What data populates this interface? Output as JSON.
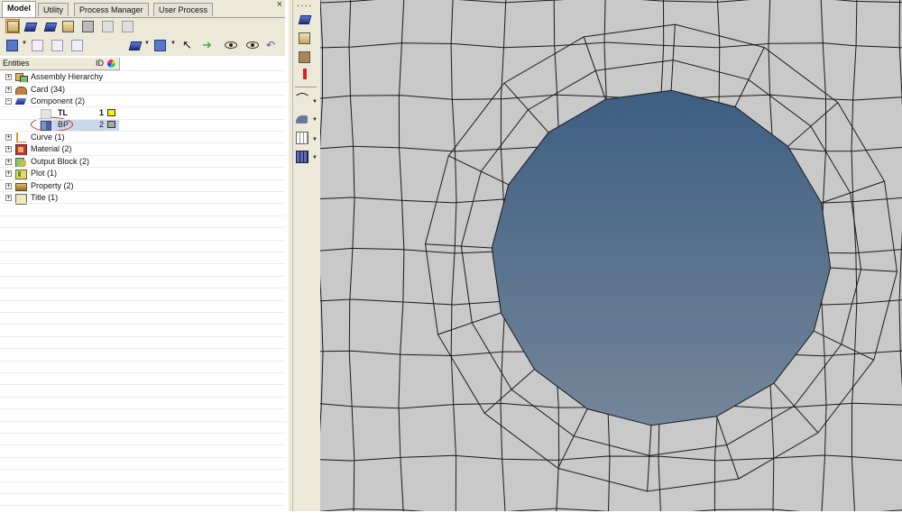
{
  "tabs": [
    {
      "label": "Model",
      "active": true
    },
    {
      "label": "Utility",
      "active": false
    },
    {
      "label": "Process Manager",
      "active": false
    },
    {
      "label": "User Process",
      "active": false
    }
  ],
  "tab_close_glyph": "×",
  "entity_columns": {
    "entities": "Entities",
    "id": "ID"
  },
  "tree": [
    {
      "label": "Assembly Hierarchy",
      "expander": "+",
      "icon": "assembly-icon"
    },
    {
      "label": "Card (34)",
      "expander": "+",
      "icon": "card-icon"
    },
    {
      "label": "Component (2)",
      "expander": "−",
      "icon": "component-icon"
    },
    {
      "label": "TL",
      "id": "1",
      "color": "#f5f200",
      "child": true,
      "bold": true,
      "icon": "component-item-icon"
    },
    {
      "label": "BP",
      "id": "2",
      "color": "#a8a8a8",
      "child": true,
      "selected": true,
      "icon": "component-item-icon"
    },
    {
      "label": "Curve (1)",
      "expander": "+",
      "icon": "curve-icon"
    },
    {
      "label": "Material (2)",
      "expander": "+",
      "icon": "material-icon"
    },
    {
      "label": "Output Block (2)",
      "expander": "+",
      "icon": "output-block-icon"
    },
    {
      "label": "Plot (1)",
      "expander": "+",
      "icon": "plot-icon"
    },
    {
      "label": "Property (2)",
      "expander": "+",
      "icon": "property-icon"
    },
    {
      "label": "Title (1)",
      "expander": "+",
      "icon": "title-icon"
    }
  ],
  "colors": {
    "mesh_bg": "#c9c9c9",
    "hole_top": "#3e5f82",
    "hole_bottom": "#74869a",
    "selection": "#c8d8ea"
  }
}
